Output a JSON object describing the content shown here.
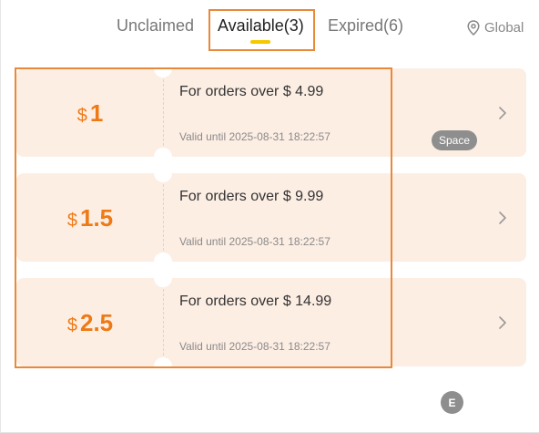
{
  "tabs": {
    "unclaimed": "Unclaimed",
    "available": "Available(3)",
    "expired": "Expired(6)"
  },
  "region": {
    "label": "Global",
    "icon": "location-pin-icon"
  },
  "coupons": [
    {
      "currency": "$",
      "amount": "1",
      "condition": "For orders over $ 4.99",
      "valid": "Valid until 2025-08-31 18:22:57"
    },
    {
      "currency": "$",
      "amount": "1.5",
      "condition": "For orders over $ 9.99",
      "valid": "Valid until 2025-08-31 18:22:57"
    },
    {
      "currency": "$",
      "amount": "2.5",
      "condition": "For orders over $ 14.99",
      "valid": "Valid until 2025-08-31 18:22:57"
    }
  ],
  "hints": {
    "space": "Space",
    "e": "E"
  },
  "colors": {
    "accent": "#ee7a16",
    "card_bg": "#fdeee4",
    "highlight_box": "#e8893a",
    "tab_underline": "#f5c800"
  }
}
